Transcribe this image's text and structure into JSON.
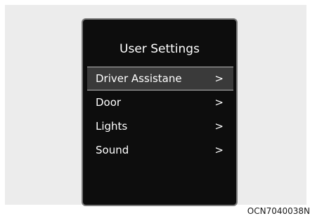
{
  "screen": {
    "title": "User Settings",
    "menu": [
      {
        "label": "Driver Assistane",
        "icon": "chevron-right-icon",
        "selected": true
      },
      {
        "label": "Door",
        "icon": "chevron-right-icon",
        "selected": false
      },
      {
        "label": "Lights",
        "icon": "chevron-right-icon",
        "selected": false
      },
      {
        "label": "Sound",
        "icon": "chevron-right-icon",
        "selected": false
      }
    ]
  },
  "caption": "OCN7040038N",
  "colors": {
    "screen_bg": "#0d0d0d",
    "selected_bg": "#3a3a3a",
    "frame_bg": "#ececec",
    "text": "#ffffff"
  }
}
